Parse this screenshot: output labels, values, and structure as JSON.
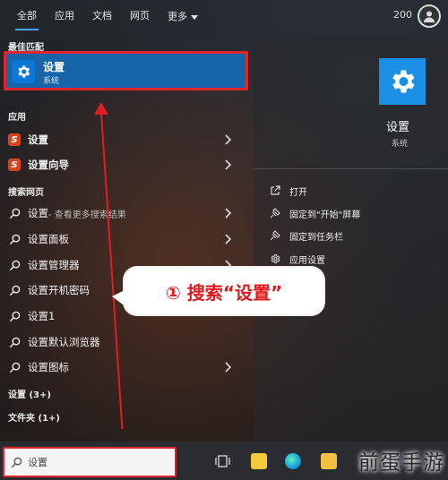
{
  "tabs": [
    "全部",
    "应用",
    "文档",
    "网页",
    "更多"
  ],
  "points": "200",
  "left": {
    "best_match_header": "最佳匹配",
    "best_match": {
      "title": "设置",
      "subtitle": "系统"
    },
    "apps_header": "应用",
    "apps": [
      "设置",
      "设置向导"
    ],
    "web_header": "搜索网页",
    "web_first": {
      "main": "设置",
      "suffix": " - 查看更多搜索结果"
    },
    "web_items": [
      "设置面板",
      "设置管理器",
      "设置开机密码",
      "设置1",
      "设置默认浏览器",
      "设置图标"
    ],
    "more_settings": "设置 (3+)",
    "more_folders": "文件夹 (1+)"
  },
  "right": {
    "title": "设置",
    "subtitle": "系统",
    "actions": [
      "打开",
      "固定到\"开始\"屏幕",
      "固定到任务栏",
      "应用设置"
    ]
  },
  "callout": "① 搜索“设置”",
  "taskbar": {
    "search_value": "设置"
  },
  "watermark": "前蛋手游",
  "colors": {
    "accent": "#1565a8",
    "highlight_red": "#e0262a",
    "icon_blue": "#1b8fe6"
  }
}
